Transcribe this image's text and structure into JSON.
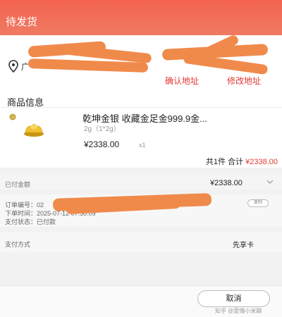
{
  "header": {
    "title": "待发货"
  },
  "address": {
    "confirm_label": "确认地址",
    "modify_label": "修改地址",
    "province_glyph": "广"
  },
  "goods": {
    "section_title": "商品信息",
    "name": "乾坤金银 收藏金足金999.9金...",
    "spec": "2g（1*2g）",
    "price": "¥2338.00",
    "qty": "x1",
    "total_prefix": "共1件 合计",
    "total_amount": "¥2338.00"
  },
  "payment": {
    "paid_label": "已付金额",
    "paid_value": "¥2338.00",
    "method_label": "支付方式",
    "method_value": "先享卡"
  },
  "order": {
    "number_label": "订单编号：",
    "number_value": "02",
    "time_label": "下单时间：",
    "time_value": "2025-07-12 07:50:09",
    "status_label": "支付状态：",
    "status_value": "已付款",
    "copy_label": "复制"
  },
  "footer": {
    "cancel_label": "取消",
    "watermark": "知乎 @爱情小米聊"
  },
  "colors": {
    "header": "#f3634f",
    "accent": "#e53935",
    "redaction": "#f08a4b"
  }
}
